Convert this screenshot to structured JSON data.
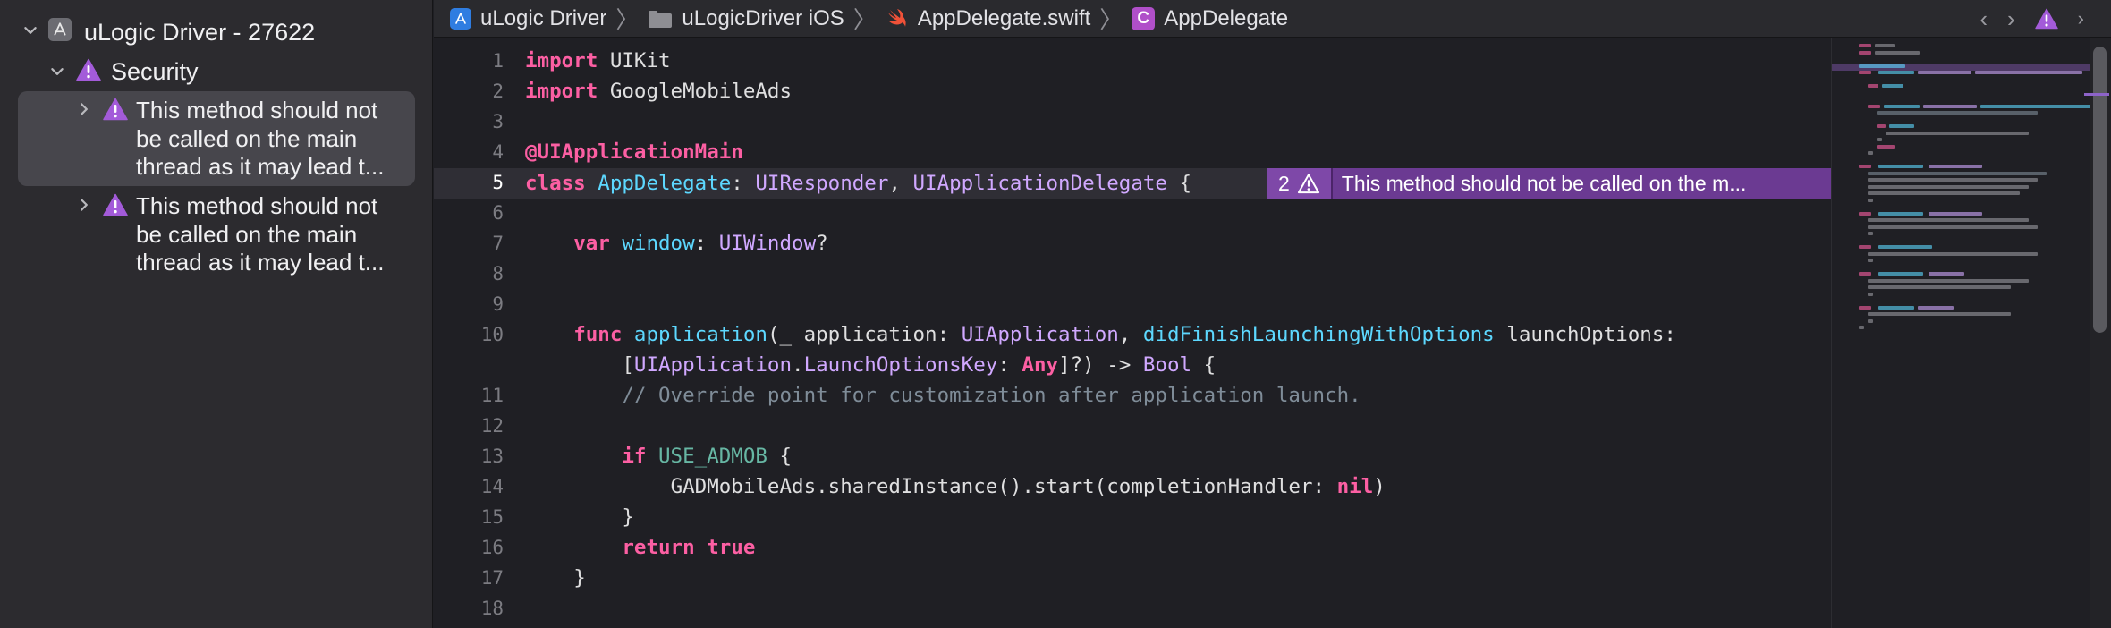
{
  "navigator": {
    "project": "uLogic Driver - 27622",
    "group": "Security",
    "issues": [
      {
        "text": "This method should not be called on the main thread as it may lead t..."
      },
      {
        "text": "This method should not be called on the main thread as it may lead t..."
      }
    ]
  },
  "jumpbar": {
    "crumbs": [
      "uLogic Driver",
      "uLogicDriver iOS",
      "AppDelegate.swift",
      "AppDelegate"
    ],
    "class_icon_letter": "C"
  },
  "editor": {
    "line_numbers": [
      "1",
      "2",
      "3",
      "4",
      "5",
      "6",
      "7",
      "8",
      "9",
      "10",
      "11",
      "12",
      "13",
      "14",
      "15",
      "16",
      "17",
      "18"
    ],
    "current_line": "5",
    "issue_banner": {
      "count": "2",
      "text": "This method should not be called on the m..."
    },
    "code": {
      "l1_kw": "import",
      "l1_rest": " UIKit",
      "l2_kw": "import",
      "l2_rest": " GoogleMobileAds",
      "l4": "@UIApplicationMain",
      "l5_kw": "class",
      "l5_name": "AppDelegate",
      "l5_colon": ": ",
      "l5_t1": "UIResponder",
      "l5_comma": ", ",
      "l5_t2": "UIApplicationDelegate",
      "l5_brace": " {",
      "l7_kw": "var",
      "l7_name": "window",
      "l7_colon": ": ",
      "l7_type": "UIWindow",
      "l7_q": "?",
      "l10_kw": "func",
      "l10_name": "application",
      "l10_a": "(_ application: ",
      "l10_t1": "UIApplication",
      "l10_b": ", ",
      "l10_label": "didFinishLaunchingWithOptions",
      "l10_c": " launchOptions:",
      "l10w_a": "[",
      "l10w_t1": "UIApplication",
      "l10w_dot": ".",
      "l10w_t2": "LaunchOptionsKey",
      "l10w_b": ": ",
      "l10w_any": "Any",
      "l10w_c": "]?) -> ",
      "l10w_bool": "Bool",
      "l10w_d": " {",
      "l11": "// Override point for customization after application launch.",
      "l13_kw": "if",
      "l13_macro": "USE_ADMOB",
      "l13_rest": " {",
      "l14_a": "GADMobileAds.sharedInstance().start(completionHandler: ",
      "l14_nil": "nil",
      "l14_b": ")",
      "l15": "}",
      "l16_kw": "return",
      "l16_val": "true",
      "l17": "}"
    }
  },
  "colors": {
    "keyword": "#fc5fa3",
    "declaration": "#5dd8ff",
    "type": "#d0a8ff",
    "comment": "#7f8c98",
    "warning_purple": "#6b3a92"
  }
}
